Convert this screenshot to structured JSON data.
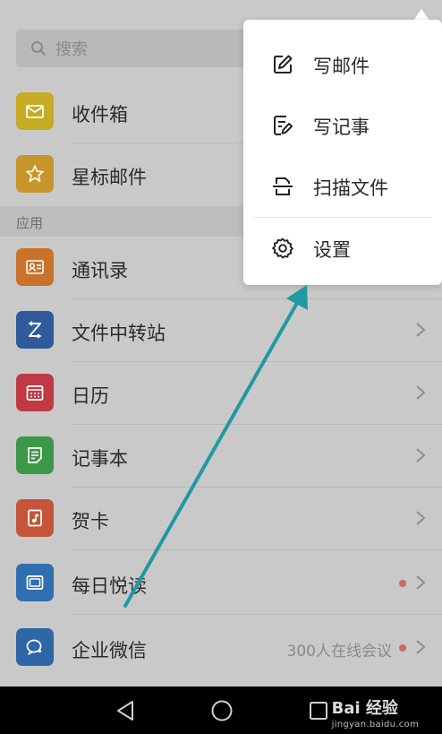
{
  "search": {
    "placeholder": "搜索"
  },
  "mail_items": [
    {
      "label": "收件箱",
      "icon": "inbox-icon",
      "color": "#c6ac22"
    },
    {
      "label": "星标邮件",
      "icon": "star-icon",
      "color": "#c7952a"
    }
  ],
  "section": {
    "title": "应用"
  },
  "apps": [
    {
      "label": "通讯录",
      "icon": "contacts-icon",
      "color": "#c9722a"
    },
    {
      "label": "文件中转站",
      "icon": "file-transfer-icon",
      "color": "#2f5b9c"
    },
    {
      "label": "日历",
      "icon": "calendar-icon",
      "color": "#bf3a45"
    },
    {
      "label": "记事本",
      "icon": "notepad-icon",
      "color": "#3b9848"
    },
    {
      "label": "贺卡",
      "icon": "greeting-card-icon",
      "color": "#c4553a"
    },
    {
      "label": "每日悦读",
      "icon": "daily-reading-icon",
      "color": "#2f6fb0"
    },
    {
      "label": "企业微信",
      "icon": "wecom-icon",
      "color": "#2e66a8",
      "extra": "300人在线会议"
    }
  ],
  "menu": {
    "items": [
      {
        "label": "写邮件",
        "icon": "compose-icon"
      },
      {
        "label": "写记事",
        "icon": "write-note-icon"
      },
      {
        "label": "扫描文件",
        "icon": "scan-document-icon"
      },
      {
        "label": "设置",
        "icon": "gear-icon"
      }
    ]
  },
  "navbar": {
    "back": "back-icon",
    "home": "home-icon",
    "recents": "recents-icon"
  },
  "watermark": {
    "main": "Bai 经验",
    "sub": "jingyan.baidu.com"
  },
  "colors": {
    "annotation_arrow": "#1e9aa0",
    "unread_dot": "#c86a6a"
  }
}
